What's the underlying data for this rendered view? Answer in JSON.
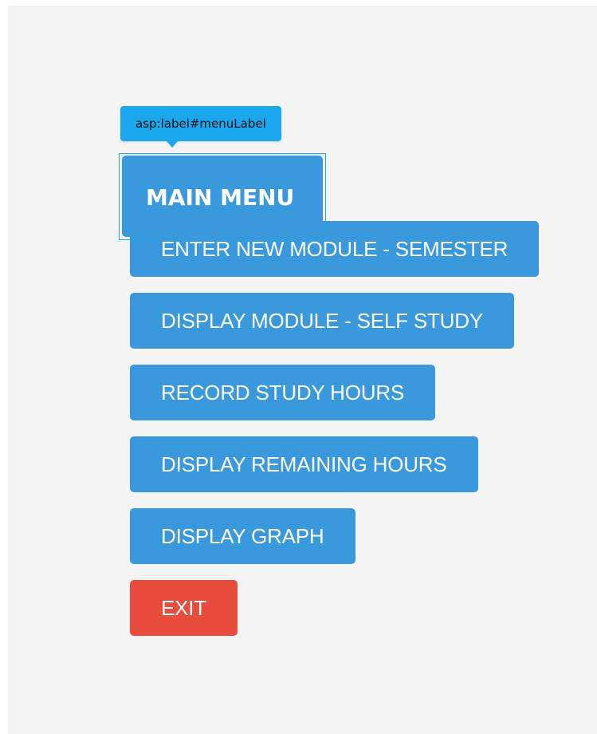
{
  "designer": {
    "tooltip_text": "asp:label#menuLabel",
    "tooltip_color": "#1aa7ee"
  },
  "menu": {
    "title": "MAIN MENU",
    "buttons": [
      {
        "id": "enter-new-module-semester",
        "label": "ENTER NEW MODULE - SEMESTER"
      },
      {
        "id": "display-module-self-study",
        "label": "DISPLAY MODULE - SELF STUDY"
      },
      {
        "id": "record-study-hours",
        "label": "RECORD STUDY HOURS"
      },
      {
        "id": "display-remaining-hours",
        "label": "DISPLAY REMAINING HOURS"
      },
      {
        "id": "display-graph",
        "label": "DISPLAY GRAPH"
      }
    ],
    "exit_label": "EXIT"
  },
  "colors": {
    "primary_button": "#3a99dd",
    "exit_button": "#e74c3c",
    "background": "#f4f4f5"
  }
}
